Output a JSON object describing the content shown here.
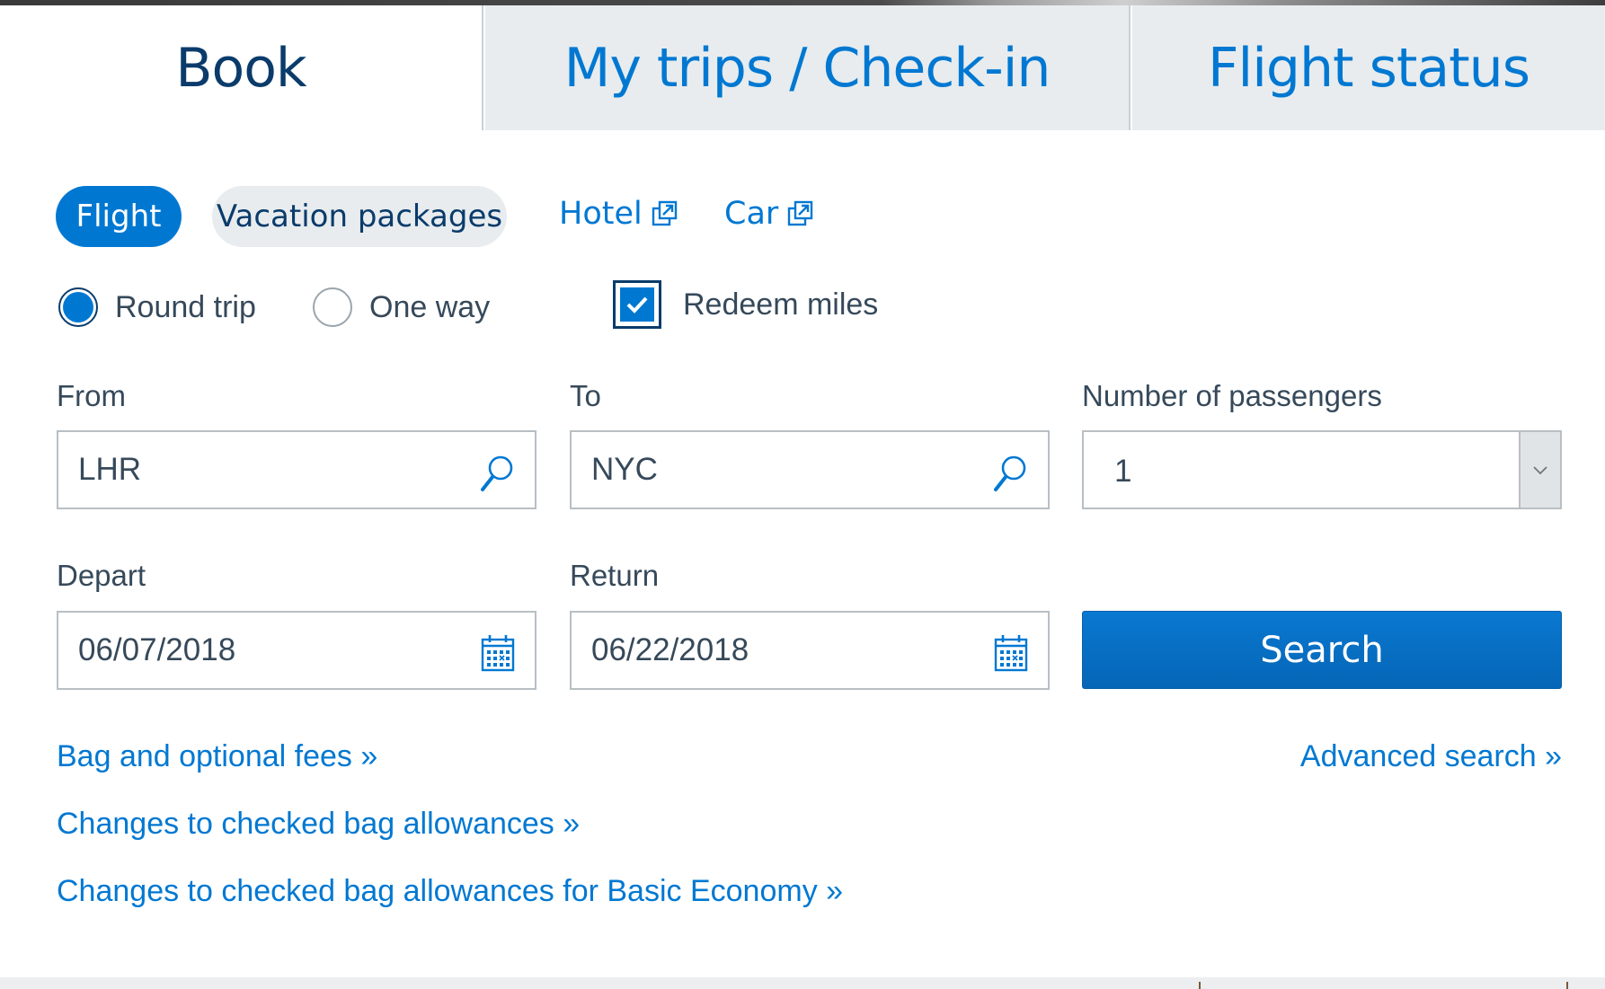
{
  "tabs": [
    {
      "label": "Book",
      "active": true
    },
    {
      "label": "My trips / Check-in",
      "active": false
    },
    {
      "label": "Flight status",
      "active": false
    }
  ],
  "product_pills": {
    "flight": "Flight",
    "vacation": "Vacation packages"
  },
  "external_links": {
    "hotel": "Hotel",
    "car": "Car"
  },
  "trip_type": {
    "round_trip": "Round trip",
    "one_way": "One way",
    "selected": "Round trip"
  },
  "redeem_miles": {
    "label": "Redeem miles",
    "checked": true
  },
  "fields": {
    "from": {
      "label": "From",
      "value": "LHR"
    },
    "to": {
      "label": "To",
      "value": "NYC"
    },
    "passengers": {
      "label": "Number of passengers",
      "value": "1"
    },
    "depart": {
      "label": "Depart",
      "value": "06/07/2018"
    },
    "return": {
      "label": "Return",
      "value": "06/22/2018"
    }
  },
  "search_button": "Search",
  "links": {
    "bag_fees": "Bag and optional fees »",
    "advanced_search": "Advanced search »",
    "bag_changes": "Changes to checked bag allowances »",
    "basic_economy": "Changes to checked bag allowances for Basic Economy »"
  },
  "colors": {
    "accent": "#0078d2",
    "navy": "#0a3b6b",
    "tab_inactive_bg": "#e8ecee",
    "text": "#36495a"
  }
}
